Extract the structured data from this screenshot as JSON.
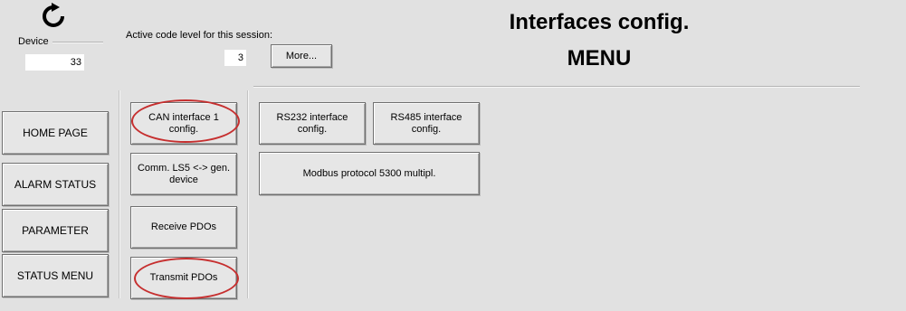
{
  "header": {
    "title": "Interfaces config.",
    "subtitle": "MENU"
  },
  "device": {
    "label": "Device",
    "value": "33"
  },
  "code_level": {
    "label": "Active code level for this session:",
    "value": "3",
    "more_label": "More..."
  },
  "nav": {
    "home": "HOME PAGE",
    "alarm": "ALARM STATUS",
    "parameter": "PARAMETER",
    "status": "STATUS MENU"
  },
  "menu": {
    "can": "CAN interface 1\nconfig.",
    "comm": "Comm. LS5 <-> gen.\ndevice",
    "receive": "Receive PDOs",
    "transmit": "Transmit PDOs",
    "rs232": "RS232 interface\nconfig.",
    "rs485": "RS485 interface\nconfig.",
    "modbus": "Modbus protocol 5300 multipl."
  },
  "icons": {
    "refresh": "refresh-icon"
  },
  "colors": {
    "background": "#e1e1e1",
    "highlight": "#c62f2f"
  }
}
